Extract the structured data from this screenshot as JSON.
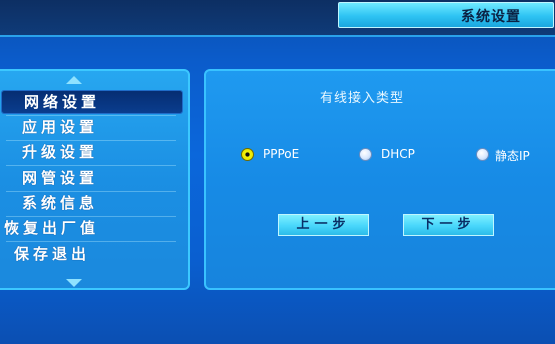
{
  "header": {
    "title": "系统设置"
  },
  "menu": {
    "items": [
      {
        "label": "网络设置",
        "selected": true
      },
      {
        "label": "应用设置",
        "selected": false
      },
      {
        "label": "升级设置",
        "selected": false
      },
      {
        "label": "网管设置",
        "selected": false
      },
      {
        "label": "系统信息",
        "selected": false
      },
      {
        "label": "恢复出厂值",
        "selected": false
      },
      {
        "label": "保存退出",
        "selected": false
      }
    ],
    "scroll_up_icon": "triangle-up",
    "scroll_down_icon": "triangle-down"
  },
  "content": {
    "section_title": "有线接入类型",
    "options": [
      {
        "label": "PPPoE",
        "checked": true
      },
      {
        "label": "DHCP",
        "checked": false
      },
      {
        "label": "静态IP",
        "checked": false
      }
    ],
    "buttons": {
      "prev": "上一步",
      "next": "下一步"
    }
  }
}
